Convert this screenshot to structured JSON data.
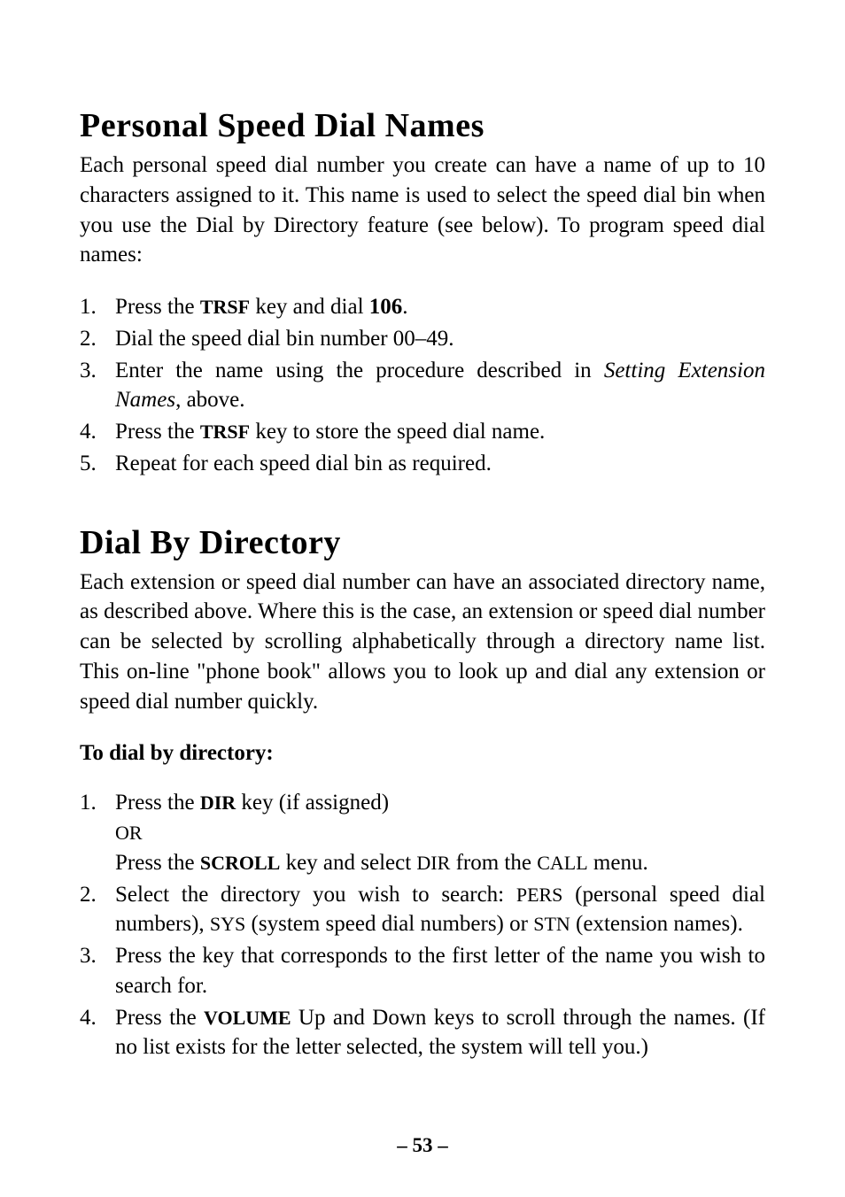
{
  "section1": {
    "heading": "Personal Speed Dial Names",
    "intro_p1": "Each personal speed dial number you create can have a name of up to 10 characters assigned to it. This name is used to select the speed dial bin when you use the Dial by Directory feature (see below). To pro",
    "intro_p2": "gram speed dial names:",
    "steps": {
      "s1": {
        "marker": "1.",
        "pre": "Press the ",
        "key": "TRSF",
        "mid": " key and dial ",
        "num": "106",
        "post": "."
      },
      "s2": {
        "marker": "2.",
        "text": "Dial the speed dial bin number 00–49."
      },
      "s3": {
        "marker": "3.",
        "pre": "Enter the name using the procedure described in ",
        "italic": "Setting Exten",
        "italic2": "sion Names",
        "post": ", above."
      },
      "s4": {
        "marker": "4.",
        "pre": "Press the ",
        "key": "TRSF",
        "post": " key to store the speed dial name."
      },
      "s5": {
        "marker": "5.",
        "text": "Repeat for each speed dial bin as required."
      }
    }
  },
  "section2": {
    "heading": "Dial By Directory",
    "intro": "Each extension or speed dial number can have an associated directory name, as described above. Where this is the case, an extension or speed dial number can be selected by scrolling alphabetically through a directory name list. This on-line \"phone book\" allows you to look up and dial any extension or speed dial number quickly.",
    "subheading": "To dial by directory:",
    "steps": {
      "s1": {
        "marker": "1.",
        "line1_pre": "Press the ",
        "line1_key": "DIR",
        "line1_post": " key (if assigned)",
        "or": "OR",
        "line2_pre": "Press the ",
        "line2_key": "SCROLL",
        "line2_mid": " key and select ",
        "line2_caps1": "DIR",
        "line2_mid2": " from the ",
        "line2_caps2": "CALL",
        "line2_post": " menu."
      },
      "s2": {
        "marker": "2.",
        "pre": "Select the directory you wish to search: ",
        "caps1": "PERS",
        "mid1": " (personal speed dial numbers), ",
        "caps2": "SYS",
        "mid2": " (system speed dial numbers) or ",
        "caps3": "STN",
        "post": " (extension names)."
      },
      "s3": {
        "marker": "3.",
        "text": "Press the key that corresponds to the first letter of the name you wish to search for."
      },
      "s4": {
        "marker": "4.",
        "pre": "Press the ",
        "key": "VOLUME",
        "post": " Up and Down keys to scroll through the names. (If no list exists for the letter selected, the system will tell you.)"
      }
    }
  },
  "footer": {
    "page": "– 53 –"
  }
}
